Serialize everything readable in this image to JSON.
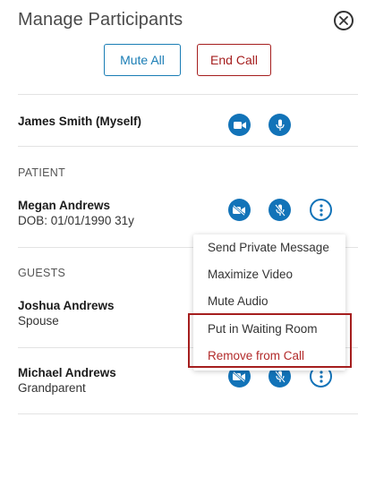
{
  "header": {
    "title": "Manage Participants"
  },
  "toolbar": {
    "mute_all_label": "Mute All",
    "end_call_label": "End Call"
  },
  "participants": {
    "self": {
      "name": "James Smith (Myself)",
      "video": "video-on",
      "audio": "mic-on"
    },
    "patient_section": "PATIENT",
    "patient": {
      "name": "Megan Andrews",
      "detail": "DOB: 01/01/1990 31y",
      "video": "video-off",
      "audio": "mic-off"
    },
    "guests_section": "GUESTS",
    "guests": [
      {
        "name": "Joshua Andrews",
        "relation": "Spouse"
      },
      {
        "name": "Michael Andrews",
        "relation": "Grandparent",
        "video": "video-off",
        "audio": "mic-off"
      }
    ]
  },
  "context_menu": {
    "items": [
      {
        "label": "Send Private Message"
      },
      {
        "label": "Maximize Video"
      },
      {
        "label": "Mute Audio"
      },
      {
        "label": "Put in Waiting Room"
      },
      {
        "label": "Remove from Call"
      }
    ]
  },
  "colors": {
    "primary": "#1273b8",
    "danger": "#a51e1e",
    "divider": "#e3e3e3"
  }
}
